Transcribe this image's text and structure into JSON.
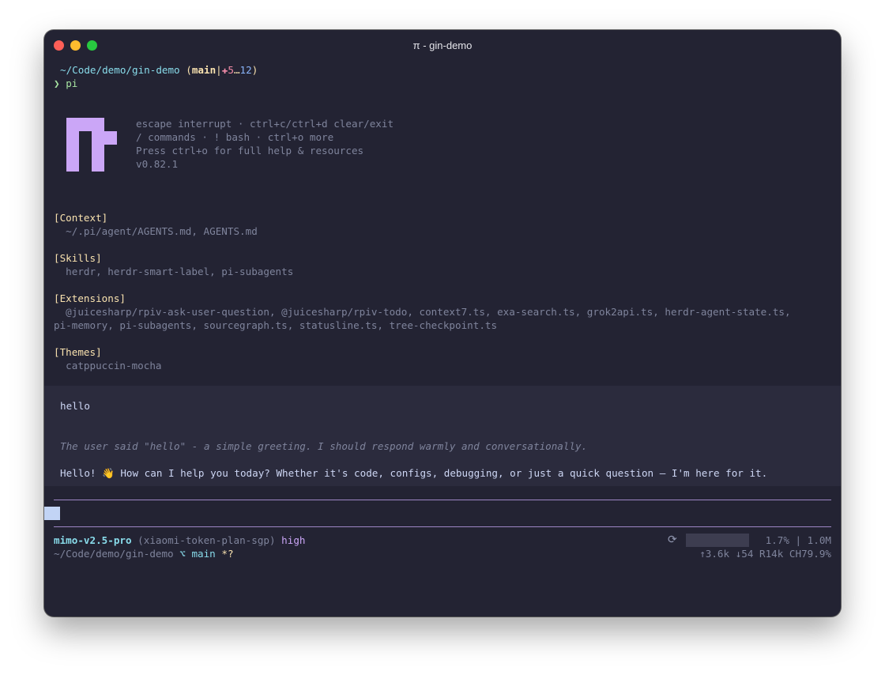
{
  "window": {
    "title": "π - gin-demo",
    "prompt_path": "~/Code/demo/gin-demo",
    "git_open": " (",
    "git_branch": "main",
    "git_sep": "|",
    "git_changes_icon": "✚",
    "git_staged": "5",
    "git_ellipsis": "…",
    "git_untracked": "12",
    "git_close": ")",
    "prompt_symbol": "❯",
    "command": "pi"
  },
  "banner": {
    "lines": [
      "escape interrupt · ctrl+c/ctrl+d clear/exit",
      "/ commands · ! bash · ctrl+o more",
      "Press ctrl+o for full help & resources",
      "v0.82.1"
    ]
  },
  "sections": [
    {
      "header": "[Context]",
      "lines": [
        "  ~/.pi/agent/AGENTS.md, AGENTS.md"
      ]
    },
    {
      "header": "[Skills]",
      "lines": [
        "  herdr, herdr-smart-label, pi-subagents"
      ]
    },
    {
      "header": "[Extensions]",
      "lines": [
        "  @juicesharp/rpiv-ask-user-question, @juicesharp/rpiv-todo, context7.ts, exa-search.ts, grok2api.ts, herdr-agent-state.ts,",
        "pi-memory, pi-subagents, sourcegraph.ts, statusline.ts, tree-checkpoint.ts"
      ]
    },
    {
      "header": "[Themes]",
      "lines": [
        "  catppuccin-mocha"
      ]
    }
  ],
  "conversation": {
    "user_message": "hello",
    "thinking": "The user said \"hello\" - a simple greeting. I should respond warmly and conversationally.",
    "response": "Hello! 👋 How can I help you today? Whether it's code, configs, debugging, or just a quick question — I'm here for it."
  },
  "statusline": {
    "model": "mimo-v2.5-pro",
    "provider": "(xiaomi-token-plan-sgp)",
    "thinking_level": "high",
    "refresh_icon": "refresh-icon",
    "context_percent": 1.7,
    "context_usage": "1.7% | 1.0M",
    "cwd": "~/Code/demo/gin-demo",
    "branch_icon": "⌥",
    "branch": "main",
    "dirty": "*?",
    "tokens": "↑3.6k ↓54 R14k CH79.9%"
  },
  "colors": {
    "background": "#232333",
    "accent": "#cba6f7",
    "prompt_cyan": "#89dceb",
    "section_yellow": "#f9e2af"
  }
}
